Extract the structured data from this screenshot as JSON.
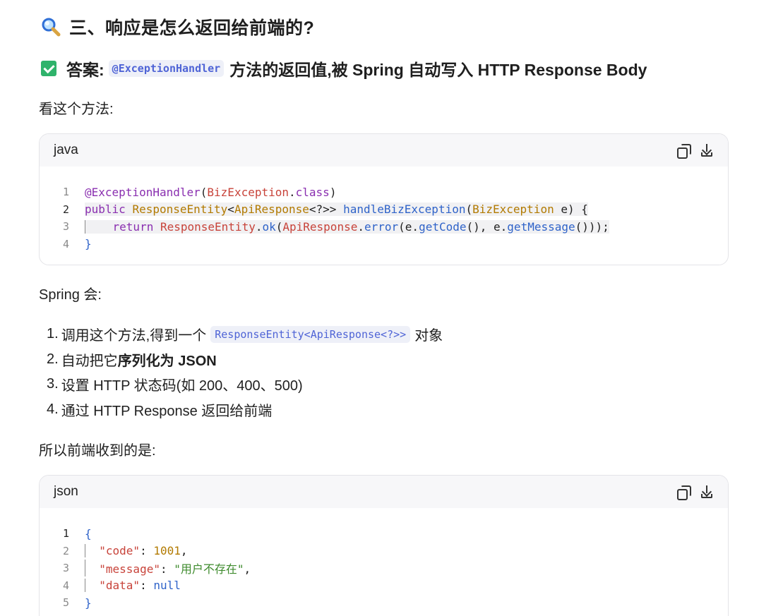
{
  "heading": {
    "text": "三、响应是怎么返回给前端的?"
  },
  "answer": {
    "label": "答案:",
    "code": "@ExceptionHandler",
    "rest": "方法的返回值,被 Spring 自动写入 HTTP Response Body"
  },
  "intro1": "看这个方法:",
  "code_java": {
    "lang": "java",
    "lines": [
      "1",
      "2",
      "3",
      "4"
    ],
    "l1": {
      "an": "@ExceptionHandler",
      "p1": "(",
      "cls": "BizException",
      "dot": ".",
      "kw": "class",
      "p2": ")"
    },
    "l2": {
      "kw": "public ",
      "ty": "ResponseEntity",
      "lt": "<",
      "ty2": "ApiResponse",
      "rest": "<?>> ",
      "fn": "handleBizException",
      "p1": "(",
      "ty3": "BizException",
      "var": " e) {"
    },
    "l3": {
      "kw": "return ",
      "cls": "ResponseEntity",
      "dot": ".",
      "fn": "ok",
      "p1": "(",
      "cls2": "ApiResponse",
      "dot2": ".",
      "fn2": "error",
      "p2": "(",
      "v1": "e.",
      "fn3": "getCode",
      "p3": "(), ",
      "v2": "e.",
      "fn4": "getMessage",
      "p4": "()));"
    },
    "l4": "}"
  },
  "intro2": "Spring 会:",
  "steps": [
    {
      "num": "1.",
      "text": "调用这个方法,得到一个",
      "code": "ResponseEntity<ApiResponse<?>>",
      "after": "对象"
    },
    {
      "num": "2.",
      "text": "自动把它",
      "bold": "序列化为 JSON"
    },
    {
      "num": "3.",
      "text": "设置 HTTP 状态码(如 200、400、500)"
    },
    {
      "num": "4.",
      "text": "通过 HTTP Response 返回给前端"
    }
  ],
  "intro3": "所以前端收到的是:",
  "code_json": {
    "lang": "json",
    "lines": [
      "1",
      "2",
      "3",
      "4",
      "5"
    ],
    "open": "{",
    "code_key": "\"code\"",
    "code_val": "1001",
    "msg_key": "\"message\"",
    "msg_val": "\"用户不存在\"",
    "data_key": "\"data\"",
    "data_val": "null",
    "close": "}"
  },
  "icons": {
    "heading": "magnifier-icon",
    "answer": "check-icon",
    "copy": "copy-icon",
    "download": "download-icon"
  },
  "colors": {
    "accent_code": "#4f64d6",
    "check": "#2fb36b"
  }
}
